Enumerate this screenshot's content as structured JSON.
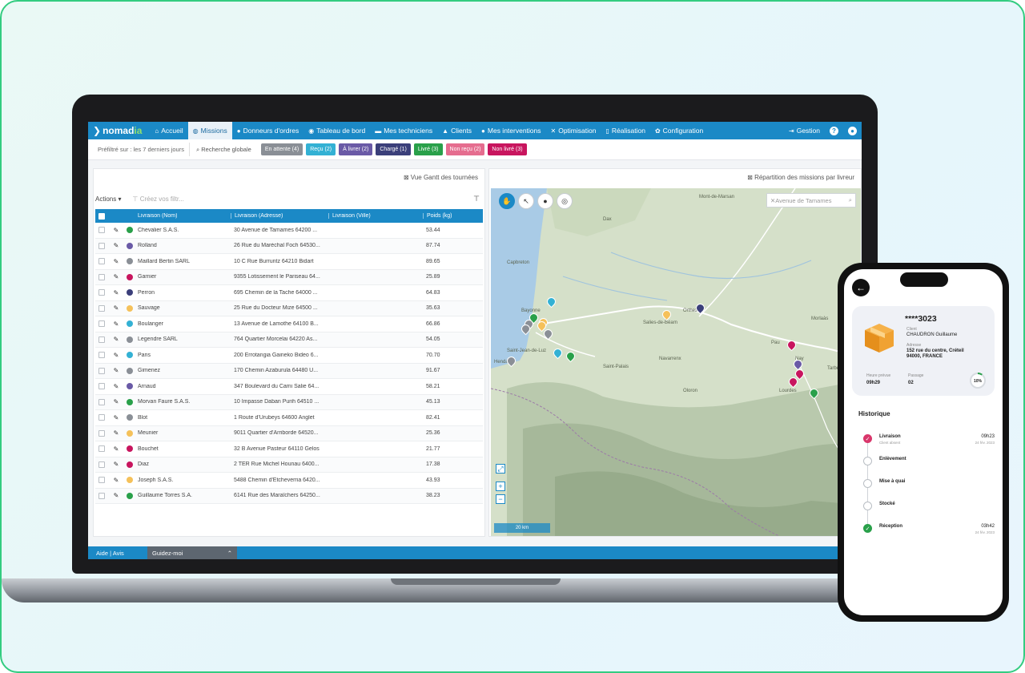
{
  "nav": {
    "brand": "nomadia",
    "brand_main": "nomad",
    "brand_accent": "ia",
    "items": [
      {
        "label": "Accueil",
        "icon": "home-icon"
      },
      {
        "label": "Missions",
        "icon": "globe-icon",
        "active": true
      },
      {
        "label": "Donneurs d'ordres",
        "icon": "map-pin-icon"
      },
      {
        "label": "Tableau de bord",
        "icon": "dashboard-icon"
      },
      {
        "label": "Mes techniciens",
        "icon": "car-icon"
      },
      {
        "label": "Clients",
        "icon": "users-icon"
      },
      {
        "label": "Mes interventions",
        "icon": "map-pin-icon"
      },
      {
        "label": "Optimisation",
        "icon": "tools-icon"
      },
      {
        "label": "Réalisation",
        "icon": "phone-icon"
      },
      {
        "label": "Configuration",
        "icon": "gear-icon"
      }
    ],
    "gestion": "Gestion",
    "help_icon": "?"
  },
  "filters": {
    "period": "Préfiltré sur : les 7 derniers jours",
    "search": "Recherche globale",
    "chips": [
      {
        "label": "En attente (4)",
        "color": "#8a8f96"
      },
      {
        "label": "Reçu (2)",
        "color": "#33b1d4"
      },
      {
        "label": "À livrer (2)",
        "color": "#6a5aa6"
      },
      {
        "label": "Chargé (1)",
        "color": "#3b3f7a"
      },
      {
        "label": "Livré (3)",
        "color": "#29a04a"
      },
      {
        "label": "Non reçu (2)",
        "color": "#e56d8f"
      },
      {
        "label": "Non livré (3)",
        "color": "#c8155e"
      }
    ]
  },
  "left": {
    "gantt": "Vue Gantt des tournées",
    "actions": "Actions",
    "filter_placeholder": "Créez vos filtr...",
    "columns": [
      "Livraison (Nom)",
      "Livraison (Adresse)",
      "Livraison (Ville)",
      "Poids (kg)"
    ],
    "rows": [
      {
        "nom": "Chevalier S.A.S.",
        "adresse": "30 Avenue de Tamames 64200 ...",
        "poids": "53.44",
        "color": "#29a04a"
      },
      {
        "nom": "Rolland",
        "adresse": "26 Rue du Maréchal Foch 64530...",
        "poids": "87.74",
        "color": "#6a5aa6"
      },
      {
        "nom": "Maillard Bertin SARL",
        "adresse": "10 C Rue Burruntz 64210 Bidart",
        "poids": "89.65",
        "color": "#8a8f96"
      },
      {
        "nom": "Garnier",
        "adresse": "9355 Lotissement le Pariseau 64...",
        "poids": "25.89",
        "color": "#c8155e"
      },
      {
        "nom": "Perron",
        "adresse": "695 Chemin de la Tache 64000 ...",
        "poids": "64.83",
        "color": "#3b3f7a"
      },
      {
        "nom": "Sauvage",
        "adresse": "25 Rue du Docteur Mize 64500 ...",
        "poids": "35.63",
        "color": "#f5c15a"
      },
      {
        "nom": "Boulanger",
        "adresse": "13 Avenue de Lamothe 64100 B...",
        "poids": "66.86",
        "color": "#33b1d4"
      },
      {
        "nom": "Legendre SARL",
        "adresse": "764 Quartier Morcelai 64220 As...",
        "poids": "54.05",
        "color": "#8a8f96"
      },
      {
        "nom": "Paris",
        "adresse": "200 Errotangia Gaineko Bideo 6...",
        "poids": "70.70",
        "color": "#33b1d4"
      },
      {
        "nom": "Gimenez",
        "adresse": "170 Chemin Azaburula 64480 U...",
        "poids": "91.67",
        "color": "#8a8f96"
      },
      {
        "nom": "Arnaud",
        "adresse": "347 Boulevard du Cami Salie 64...",
        "poids": "58.21",
        "color": "#6a5aa6"
      },
      {
        "nom": "Morvan Faure S.A.S.",
        "adresse": "10 Impasse Daban Purih 64510 ...",
        "poids": "45.13",
        "color": "#29a04a"
      },
      {
        "nom": "Blot",
        "adresse": "1 Route d'Urubeys 64600 Anglet",
        "poids": "82.41",
        "color": "#8a8f96"
      },
      {
        "nom": "Meunier",
        "adresse": "9011 Quartier d'Arriborde 64520...",
        "poids": "25.36",
        "color": "#f5c15a"
      },
      {
        "nom": "Bouchet",
        "adresse": "32 B Avenue Pasteur 64110 Gelos",
        "poids": "21.77",
        "color": "#c8155e"
      },
      {
        "nom": "Diaz",
        "adresse": "2 TER Rue Michel Hounau 6400...",
        "poids": "17.38",
        "color": "#c8155e"
      },
      {
        "nom": "Joseph S.A.S.",
        "adresse": "5488 Chemin d'Etcheverria 6420...",
        "poids": "43.93",
        "color": "#f5c15a"
      },
      {
        "nom": "Guillaume Torres S.A.",
        "adresse": "6141 Rue des Maraîchers 64250...",
        "poids": "38.23",
        "color": "#29a04a"
      }
    ]
  },
  "right": {
    "repartition": "Répartition des missions par livreur",
    "map_search": "Avenue de Tamames",
    "scale": "20 km",
    "places": [
      "Bayonne",
      "Dax",
      "Mont-de-Marsan",
      "Orthez",
      "Pau",
      "Tarbes",
      "Oloron",
      "Lourdes",
      "Saint-Jean-de-Luz",
      "Hendaye",
      "Salies-de-Béarn",
      "Navarrenx",
      "Saint-Palais",
      "Nay",
      "Morlaàs",
      "Capbreton"
    ],
    "pins": [
      {
        "color": "#33b1d4"
      },
      {
        "color": "#29a04a"
      },
      {
        "color": "#8a8f96"
      },
      {
        "color": "#f5c15a"
      },
      {
        "color": "#8a8f96"
      },
      {
        "color": "#8a8f96"
      },
      {
        "color": "#f5c15a"
      },
      {
        "color": "#33b1d4"
      },
      {
        "color": "#29a04a"
      },
      {
        "color": "#8a8f96"
      },
      {
        "color": "#f5c15a"
      },
      {
        "color": "#3b3f7a"
      },
      {
        "color": "#c8155e"
      },
      {
        "color": "#6a5aa6"
      },
      {
        "color": "#c8155e"
      },
      {
        "color": "#c8155e"
      },
      {
        "color": "#29a04a"
      }
    ]
  },
  "footer": {
    "help": "Aide | Avis",
    "guide": "Guidez-moi"
  },
  "phone": {
    "reference": "****3023",
    "client_label": "Client",
    "client": "CHAUDRON Guillaume",
    "address_label": "Adresse",
    "address_line1": "152 rue du centre, Créteil",
    "address_line2": "94000, FRANCE",
    "eta_label": "Heure prévue",
    "eta": "09h29",
    "passage_label": "Passage",
    "passage": "02",
    "progress": "10%",
    "history_title": "Historique",
    "steps": [
      {
        "title": "Livraison",
        "sub": "Client absent",
        "time": "09h23",
        "date": "24 fév. 2023",
        "state": "failed"
      },
      {
        "title": "Enlèvement",
        "sub": "",
        "time": "",
        "date": "",
        "state": "pending"
      },
      {
        "title": "Mise à quai",
        "sub": "",
        "time": "",
        "date": "",
        "state": "pending"
      },
      {
        "title": "Stocké",
        "sub": "",
        "time": "",
        "date": "",
        "state": "pending"
      },
      {
        "title": "Réception",
        "sub": "",
        "time": "03h42",
        "date": "24 fév. 2023",
        "state": "done"
      }
    ]
  }
}
